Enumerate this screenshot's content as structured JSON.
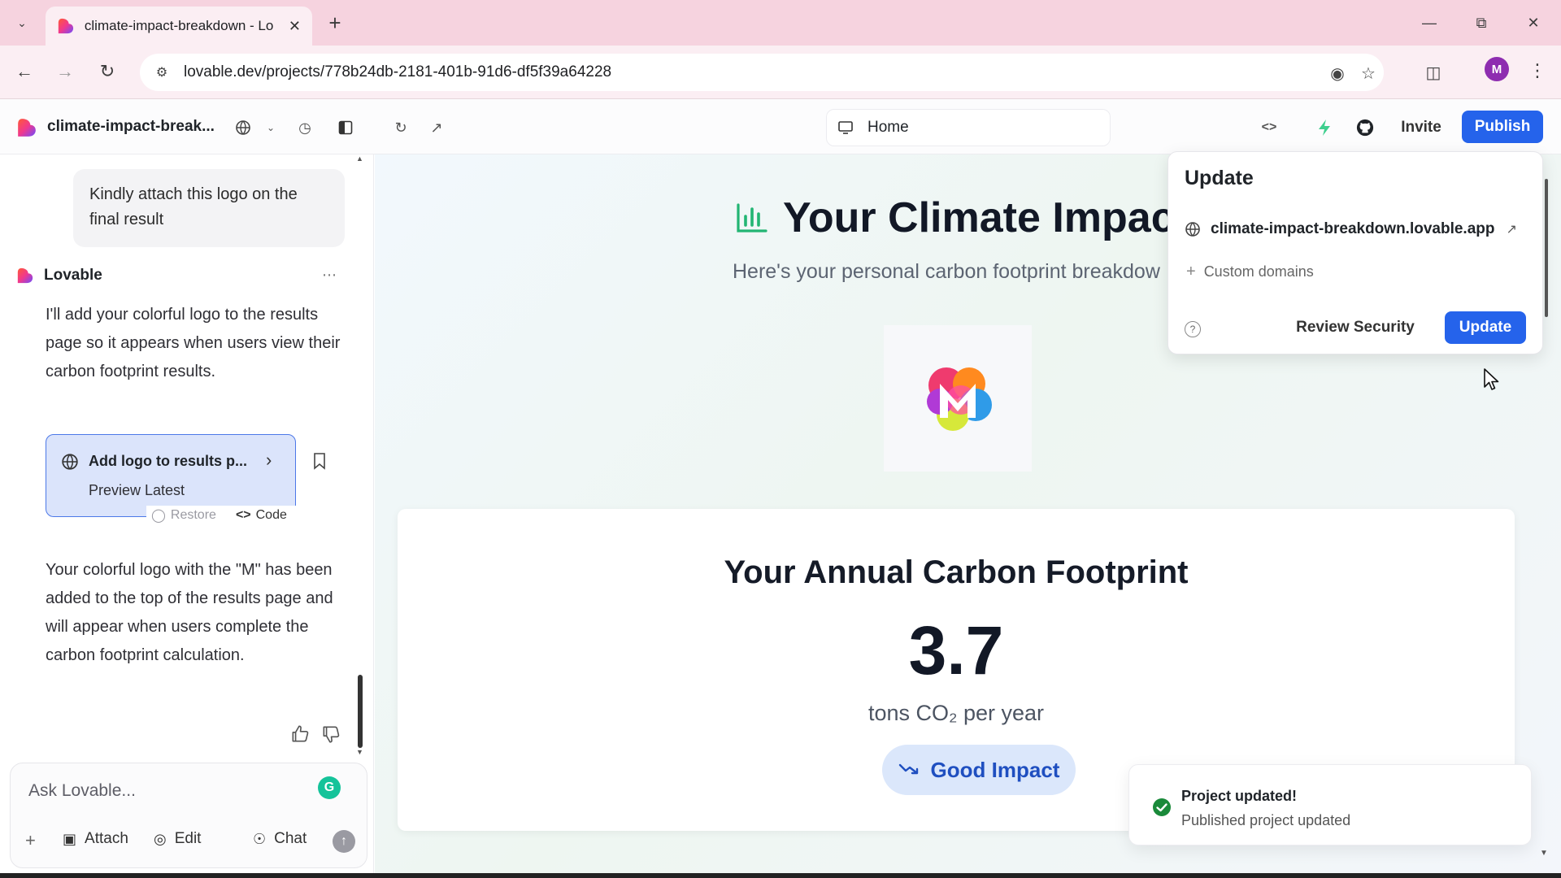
{
  "browser": {
    "tab_title": "climate-impact-breakdown - Lo",
    "url": "lovable.dev/projects/778b24db-2181-401b-91d6-df5f39a64228",
    "profile_initial": "M"
  },
  "header": {
    "project_name": "climate-impact-break...",
    "page_selector": "Home",
    "invite_label": "Invite",
    "publish_label": "Publish",
    "accent_color": "#2563eb"
  },
  "chat": {
    "user_message": "Kindly attach this logo on the final result",
    "assistant_name": "Lovable",
    "assistant_message_1": "I'll add your colorful logo to the results page so it appears when users view their carbon footprint results.",
    "version_card": {
      "title": "Add logo to results p...",
      "preview_label": "Preview Latest",
      "restore_label": "Restore",
      "code_label": "Code"
    },
    "assistant_message_2": "Your colorful logo with the \"M\" has been added to the top of the results page and will appear when users complete the carbon footprint calculation.",
    "composer": {
      "placeholder": "Ask Lovable...",
      "attach_label": "Attach",
      "edit_label": "Edit",
      "chat_label": "Chat"
    }
  },
  "preview": {
    "title": "Your Climate Impact",
    "subtitle": "Here's your personal carbon footprint breakdow",
    "logo_letter": "M",
    "card": {
      "title": "Your Annual Carbon Footprint",
      "value": "3.7",
      "unit": "tons CO₂ per year",
      "badge": "Good Impact"
    }
  },
  "update_popover": {
    "title": "Update",
    "domain": "climate-impact-breakdown.lovable.app",
    "custom_domains_label": "Custom domains",
    "review_security_label": "Review Security",
    "update_label": "Update"
  },
  "toast": {
    "title": "Project updated!",
    "description": "Published project updated",
    "status_color": "#1a8a3a"
  }
}
